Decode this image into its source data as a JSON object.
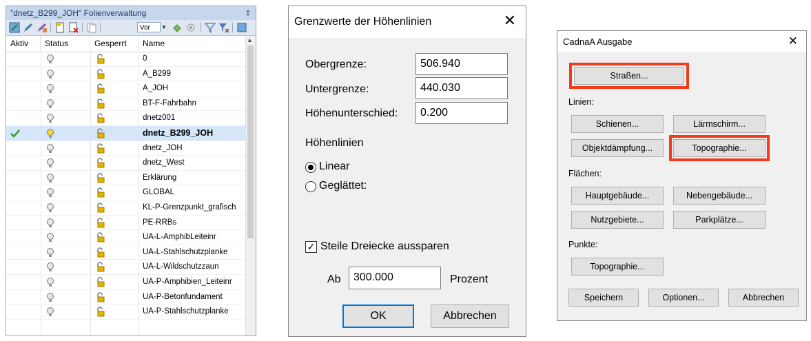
{
  "layers": {
    "title": "\"dnetz_B299_JOH\"  Folienverwaltung",
    "pin_glyph": "‡",
    "combo_value": "Vor",
    "headers": {
      "aktiv": "Aktiv",
      "status": "Status",
      "gesperrt": "Gesperrt",
      "name": "Name"
    },
    "rows": [
      {
        "name": "0",
        "active": false
      },
      {
        "name": "A_B299",
        "active": false
      },
      {
        "name": "A_JOH",
        "active": false
      },
      {
        "name": "BT-F-Fahrbahn",
        "active": false
      },
      {
        "name": "dnetz001",
        "active": false
      },
      {
        "name": "dnetz_B299_JOH",
        "active": true
      },
      {
        "name": "dnetz_JOH",
        "active": false
      },
      {
        "name": "dnetz_West",
        "active": false
      },
      {
        "name": "Erklärung",
        "active": false
      },
      {
        "name": "GLOBAL",
        "active": false
      },
      {
        "name": "KL-P-Grenzpunkt_grafisch",
        "active": false
      },
      {
        "name": "PE-RRBs",
        "active": false
      },
      {
        "name": "UA-L-AmphibLeiteinr",
        "active": false
      },
      {
        "name": "UA-L-Stahlschutzplanke",
        "active": false
      },
      {
        "name": "UA-L-Wildschutzzaun",
        "active": false
      },
      {
        "name": "UA-P-Amphibien_Leiteinr",
        "active": false
      },
      {
        "name": "UA-P-Betonfundament",
        "active": false
      },
      {
        "name": "UA-P-Stahlschutzplanke",
        "active": false
      }
    ],
    "colors": {
      "selected_row": "#d4e6f8",
      "check": "#3a9a2a",
      "lock": "#e0b400"
    }
  },
  "grenz": {
    "title": "Grenzwerte der Höhenlinien",
    "obergrenze_label": "Obergrenze:",
    "obergrenze_value": "506.940",
    "untergrenze_label": "Untergrenze:",
    "untergrenze_value": "440.030",
    "unterschied_label": "Höhenunterschied:",
    "unterschied_value": "0.200",
    "group_label": "Höhenlinien",
    "linear_label": "Linear",
    "geglaettet_label": "Geglättet:",
    "steile_label": "Steile Dreiecke aussparen",
    "ab_label": "Ab",
    "ab_value": "300.000",
    "prozent_label": "Prozent",
    "ok_label": "OK",
    "abbrechen_label": "Abbrechen"
  },
  "cadna": {
    "title": "CadnaA Ausgabe",
    "strassen": "Straßen...",
    "linien_label": "Linien:",
    "schienen": "Schienen...",
    "laermschirm": "Lärmschirm...",
    "objektdaempfung": "Objektdämpfung...",
    "topographie_linien": "Topographie...",
    "flaechen_label": "Flächen:",
    "hauptgebaeude": "Hauptgebäude...",
    "nebengebaeude": "Nebengebäude...",
    "nutzgebiete": "Nutzgebiete...",
    "parkplaetze": "Parkplätze...",
    "punkte_label": "Punkte:",
    "topographie_punkte": "Topographie...",
    "speichern": "Speichern",
    "optionen": "Optionen...",
    "abbrechen": "Abbrechen",
    "highlight_color": "#f03b1e"
  }
}
